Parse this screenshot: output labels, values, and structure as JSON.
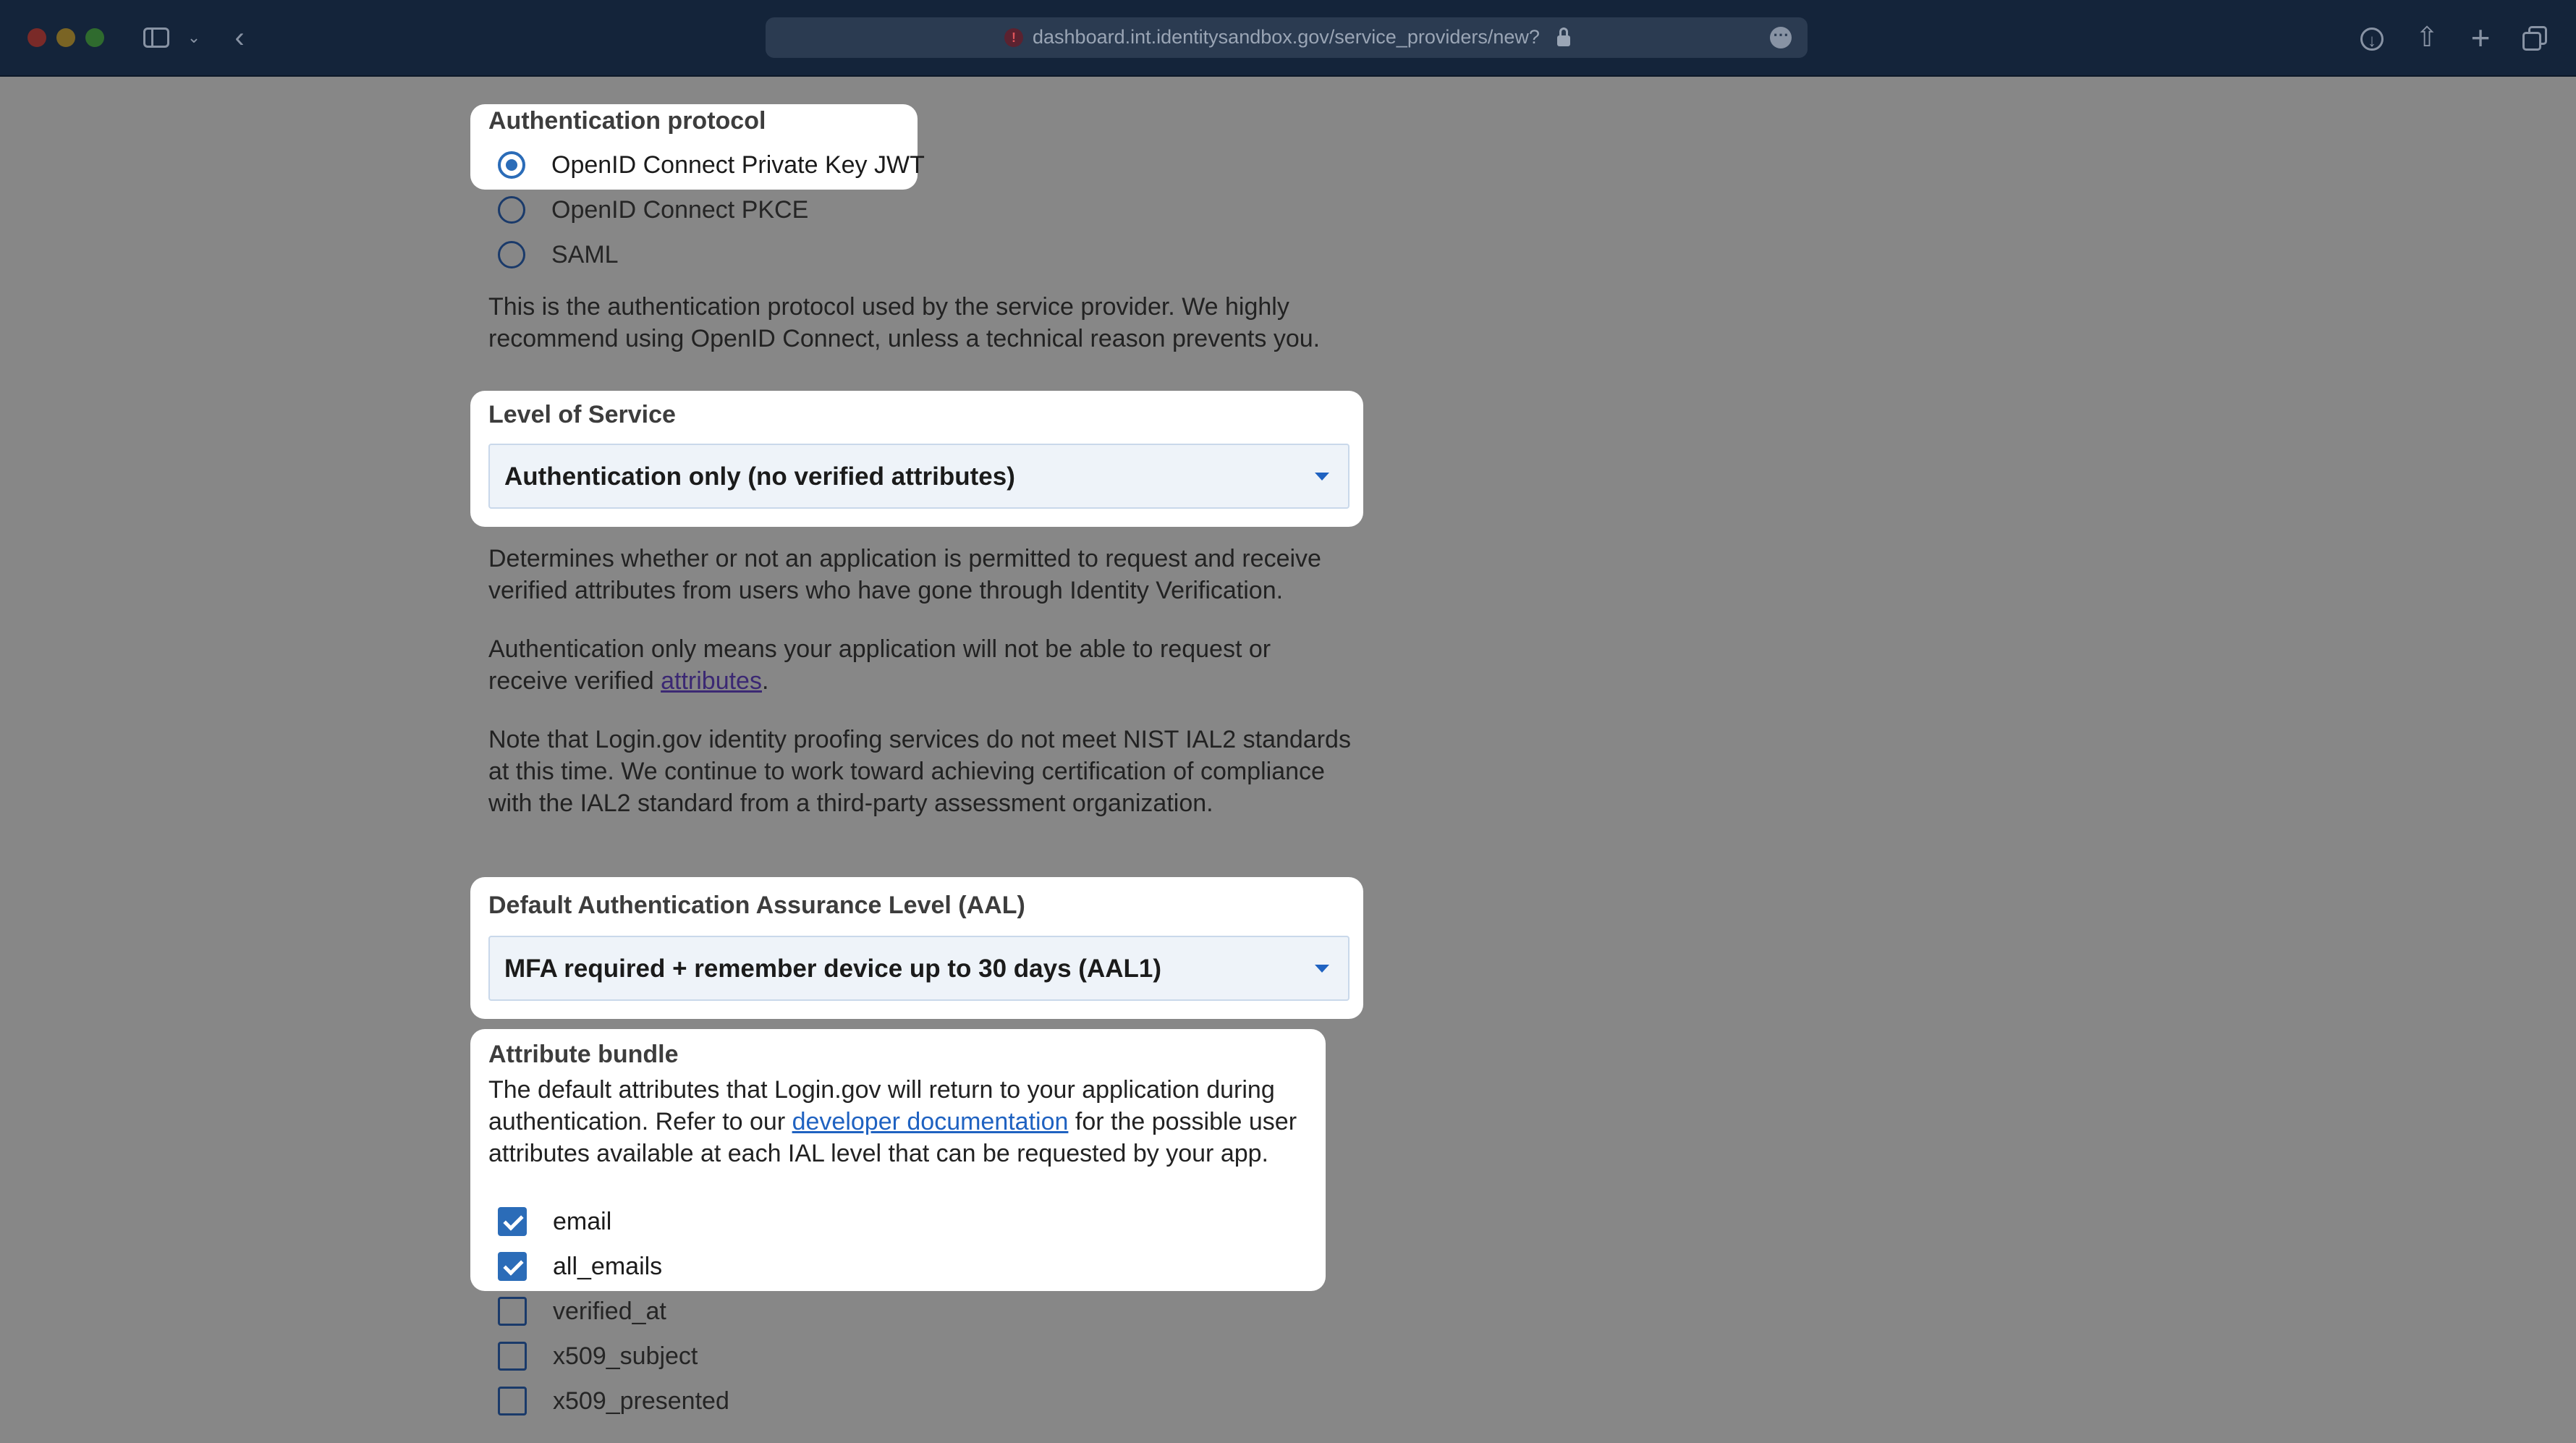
{
  "browser": {
    "url": "dashboard.int.identitysandbox.gov/service_providers/new?",
    "url_alert_glyph": "!",
    "icons": [
      "sidebar-icon",
      "chevron-down-icon",
      "back-icon",
      "lock-icon",
      "more-icon",
      "download-icon",
      "share-icon",
      "plus-icon",
      "tabs-icon"
    ]
  },
  "auth_protocol": {
    "label": "Authentication protocol",
    "options": [
      {
        "label": "OpenID Connect Private Key JWT",
        "checked": true
      },
      {
        "label": "OpenID Connect PKCE",
        "checked": false
      },
      {
        "label": "SAML",
        "checked": false
      }
    ],
    "help_line1": "This is the authentication protocol used by the service provider. We highly",
    "help_line2": "recommend using OpenID Connect, unless a technical reason prevents you."
  },
  "level_of_service": {
    "label": "Level of Service",
    "selected": "Authentication only (no verified attributes)",
    "desc1_line1": "Determines whether or not an application is permitted to request and receive",
    "desc1_line2": "verified attributes from users who have gone through Identity Verification.",
    "desc2_line1": "Authentication only means your application will not be able to request or",
    "desc2_line2_prefix": "receive verified ",
    "desc2_link": "attributes",
    "desc2_suffix": ".",
    "desc3_line1": "Note that Login.gov identity proofing services do not meet NIST IAL2 standards",
    "desc3_line2": "at this time. We continue to work toward achieving certification of compliance",
    "desc3_line3": "with the IAL2 standard from a third-party assessment organization."
  },
  "aal": {
    "label": "Default Authentication Assurance Level (AAL)",
    "selected": "MFA required + remember device up to 30 days (AAL1)"
  },
  "attribute_bundle": {
    "label": "Attribute bundle",
    "desc_line1": "The default attributes that Login.gov will return to your application during",
    "desc_line2_prefix": "authentication. Refer to our ",
    "desc_link": "developer documentation",
    "desc_line2_suffix": " for the possible user",
    "desc_line3": "attributes available at each IAL level that can be requested by your app.",
    "items": [
      {
        "label": "email",
        "checked": true
      },
      {
        "label": "all_emails",
        "checked": true
      },
      {
        "label": "verified_at",
        "checked": false
      },
      {
        "label": "x509_subject",
        "checked": false
      },
      {
        "label": "x509_presented",
        "checked": false
      }
    ]
  },
  "colors": {
    "accent": "#2b6cb8",
    "chrome": "#14243a",
    "overlay": "#878787"
  }
}
